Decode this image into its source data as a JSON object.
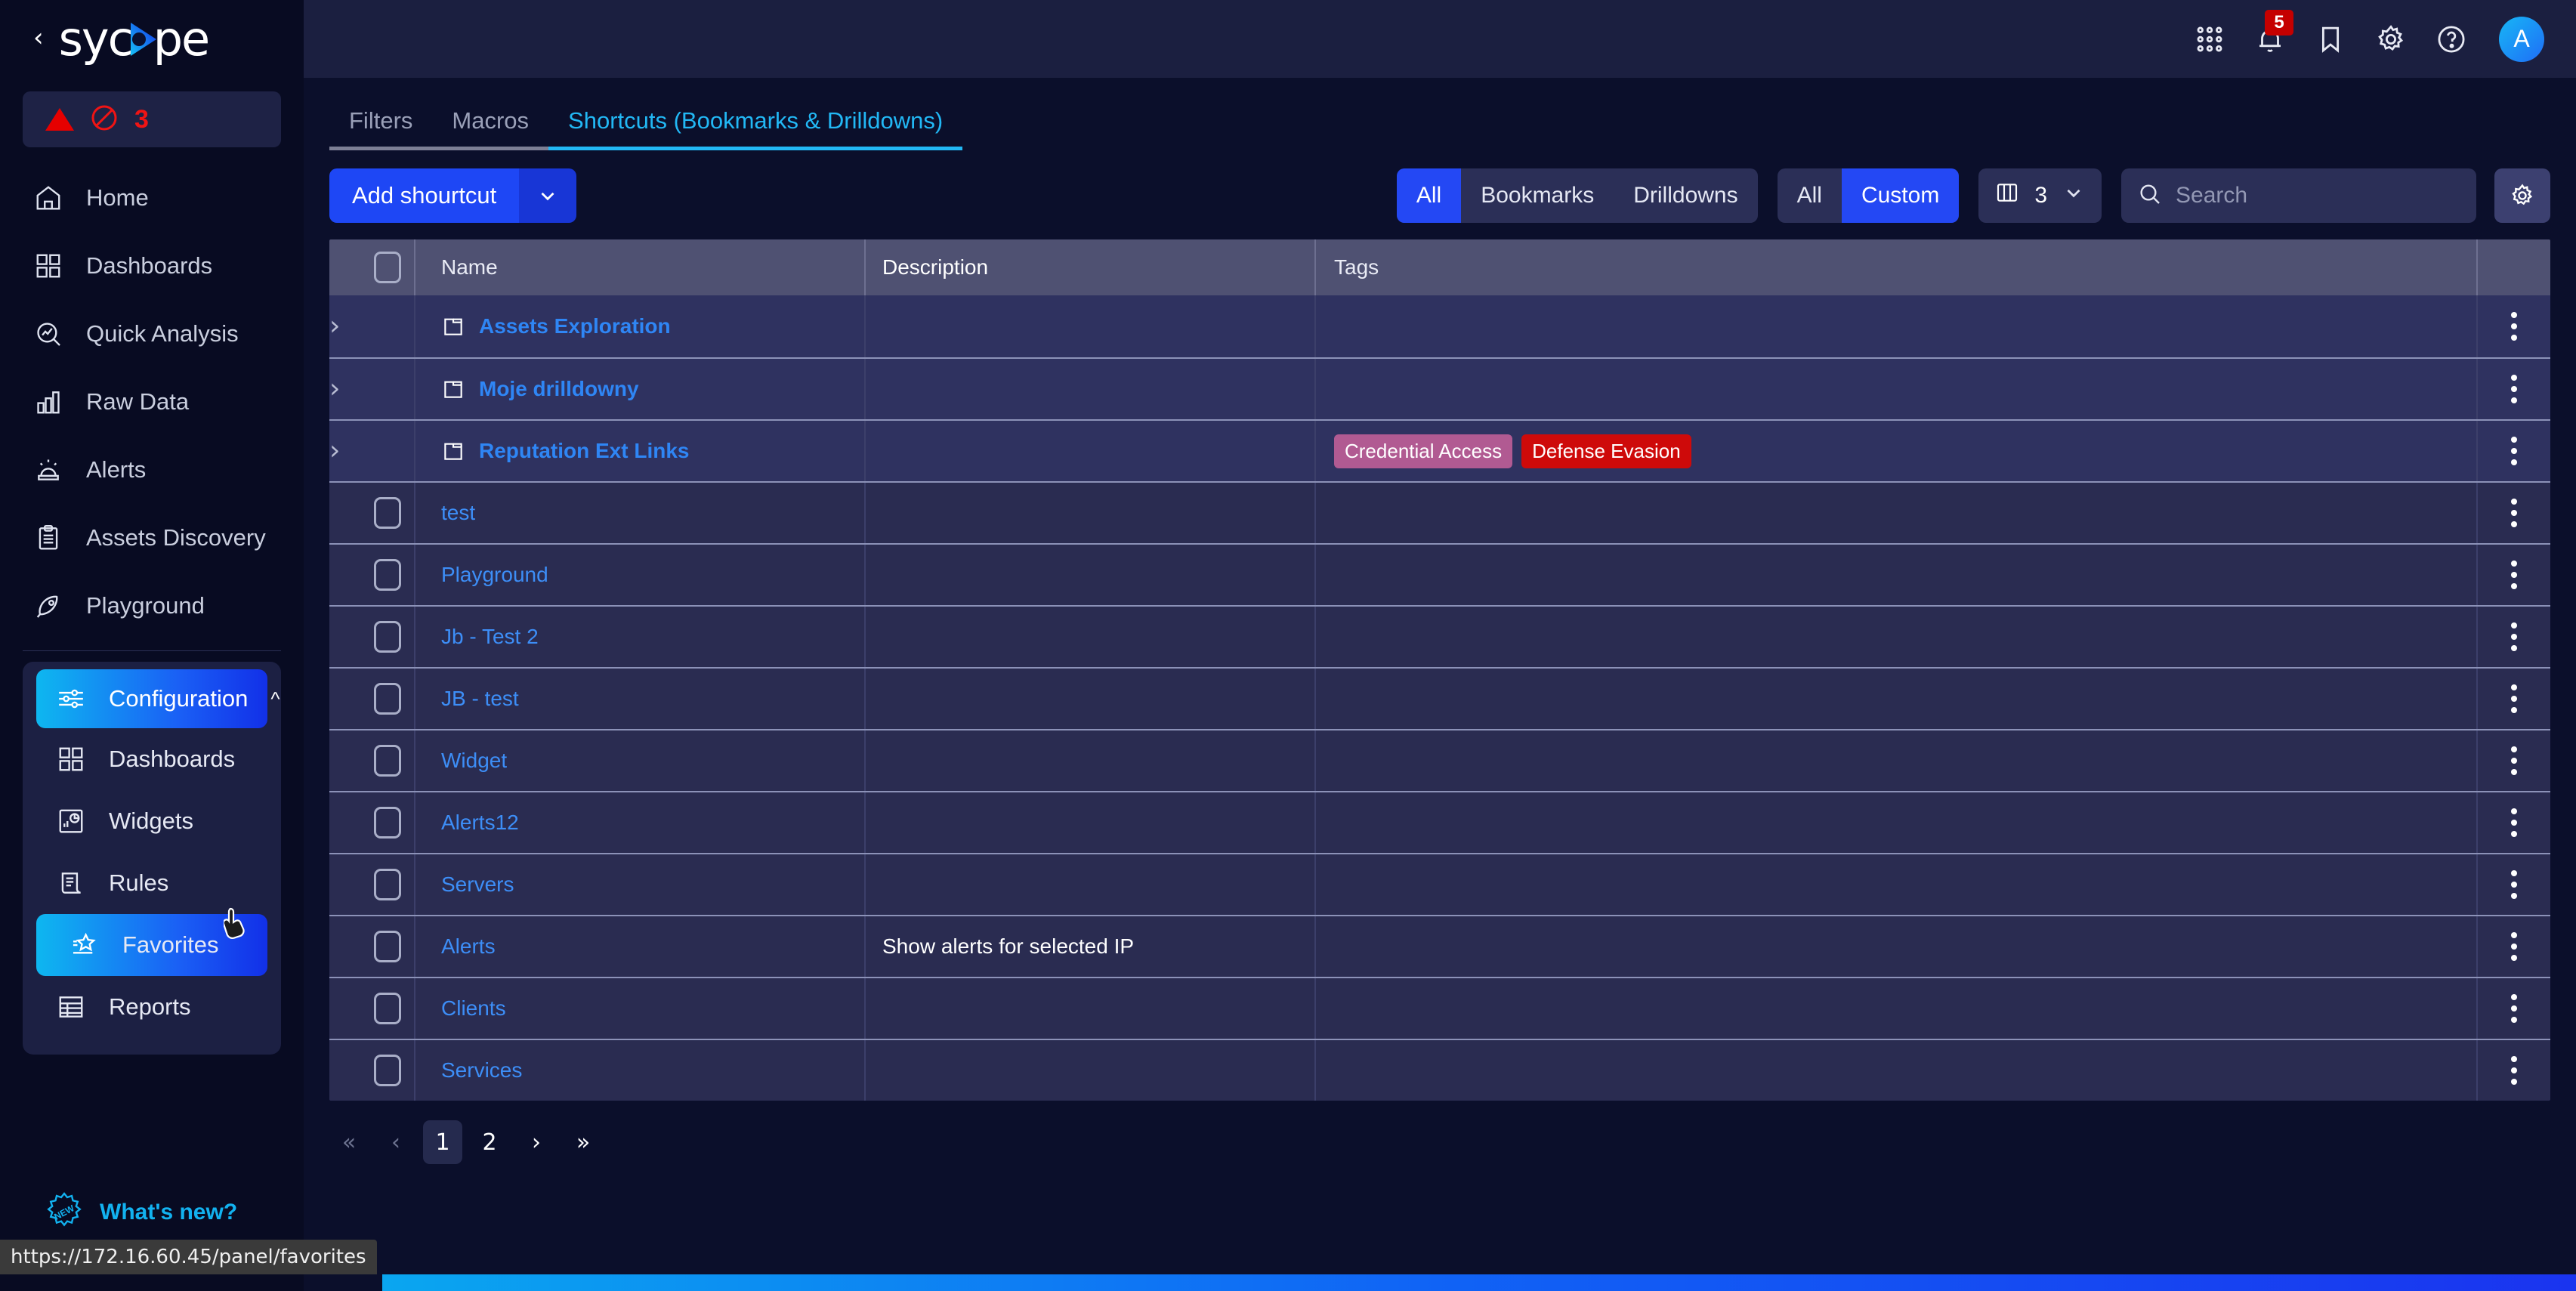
{
  "sidebar": {
    "logo_text_left": "syc",
    "logo_text_right": "pe",
    "collapse_icon": "chevron-left-icon",
    "alert_chip": {
      "count": "3",
      "warning_icon": "warning-triangle-icon",
      "blocked_icon": "blocked-circle-icon"
    },
    "nav": [
      {
        "label": "Home",
        "icon": "home-icon"
      },
      {
        "label": "Dashboards",
        "icon": "grid-icon"
      },
      {
        "label": "Quick Analysis",
        "icon": "analysis-magnifier-icon"
      },
      {
        "label": "Raw Data",
        "icon": "bar-chart-icon"
      },
      {
        "label": "Alerts",
        "icon": "siren-icon"
      },
      {
        "label": "Assets Discovery",
        "icon": "clipboard-icon"
      },
      {
        "label": "Playground",
        "icon": "rocket-icon"
      }
    ],
    "config": {
      "label": "Configuration",
      "icon": "sliders-icon",
      "chevron": "chevron-up-icon",
      "items": [
        {
          "label": "Dashboards",
          "icon": "grid-icon",
          "active": false
        },
        {
          "label": "Widgets",
          "icon": "widgets-icon",
          "active": false
        },
        {
          "label": "Rules",
          "icon": "scroll-icon",
          "active": false
        },
        {
          "label": "Favorites",
          "icon": "star-list-icon",
          "active": true
        },
        {
          "label": "Reports",
          "icon": "table-icon",
          "active": false
        }
      ]
    },
    "whats_new": {
      "label": "What's new?",
      "icon": "new-badge-icon"
    }
  },
  "status_url": "https://172.16.60.45/panel/favorites",
  "topbar": {
    "icons": [
      {
        "name": "apps-grid-icon"
      },
      {
        "name": "bell-icon",
        "badge": "5"
      },
      {
        "name": "bookmark-icon"
      },
      {
        "name": "gear-icon"
      },
      {
        "name": "help-icon"
      }
    ],
    "avatar_initial": "A"
  },
  "tabs": [
    {
      "label": "Filters",
      "active": false
    },
    {
      "label": "Macros",
      "active": false
    },
    {
      "label": "Shortcuts (Bookmarks & Drilldowns)",
      "active": true
    }
  ],
  "toolbar": {
    "add_button": "Add shourtcut",
    "add_dropdown_icon": "chevron-down-icon",
    "type_filter": [
      {
        "label": "All",
        "on": true
      },
      {
        "label": "Bookmarks",
        "on": false
      },
      {
        "label": "Drilldowns",
        "on": false
      }
    ],
    "scope_filter": [
      {
        "label": "All",
        "on": false
      },
      {
        "label": "Custom",
        "on": true
      }
    ],
    "columns": {
      "icon": "columns-icon",
      "value": "3",
      "chevron": "chevron-down-icon"
    },
    "search": {
      "icon": "search-icon",
      "value": "",
      "placeholder": "Search"
    },
    "settings_icon": "gear-icon"
  },
  "table": {
    "headers": {
      "name": "Name",
      "description": "Description",
      "tags": "Tags"
    },
    "rows": [
      {
        "type": "folder",
        "name": "Assets Exploration",
        "description": "",
        "tags": []
      },
      {
        "type": "folder",
        "name": "Moje drilldowny",
        "description": "",
        "tags": []
      },
      {
        "type": "folder",
        "name": "Reputation Ext Links",
        "description": "",
        "tags": [
          {
            "label": "Credential Access",
            "color": "#b15a92"
          },
          {
            "label": "Defense Evasion",
            "color": "#ce0a0a"
          }
        ]
      },
      {
        "type": "item",
        "name": "test",
        "description": "",
        "tags": []
      },
      {
        "type": "item",
        "name": "Playground",
        "description": "",
        "tags": []
      },
      {
        "type": "item",
        "name": "Jb - Test 2",
        "description": "",
        "tags": []
      },
      {
        "type": "item",
        "name": "JB - test",
        "description": "",
        "tags": []
      },
      {
        "type": "item",
        "name": "Widget",
        "description": "",
        "tags": []
      },
      {
        "type": "item",
        "name": "Alerts12",
        "description": "",
        "tags": []
      },
      {
        "type": "item",
        "name": "Servers",
        "description": "",
        "tags": []
      },
      {
        "type": "item",
        "name": "Alerts",
        "description": "Show alerts for selected IP",
        "tags": []
      },
      {
        "type": "item",
        "name": "Clients",
        "description": "",
        "tags": []
      },
      {
        "type": "item",
        "name": "Services",
        "description": "",
        "tags": []
      }
    ]
  },
  "pagination": {
    "first": "«",
    "prev": "‹",
    "next": "›",
    "last": "»",
    "pages": [
      {
        "label": "1",
        "current": true
      },
      {
        "label": "2",
        "current": false
      }
    ]
  },
  "colors": {
    "accent_cyan": "#22b8f5",
    "accent_blue": "#2448f4",
    "danger_red": "#c50000",
    "link_blue": "#3d8ef7"
  }
}
